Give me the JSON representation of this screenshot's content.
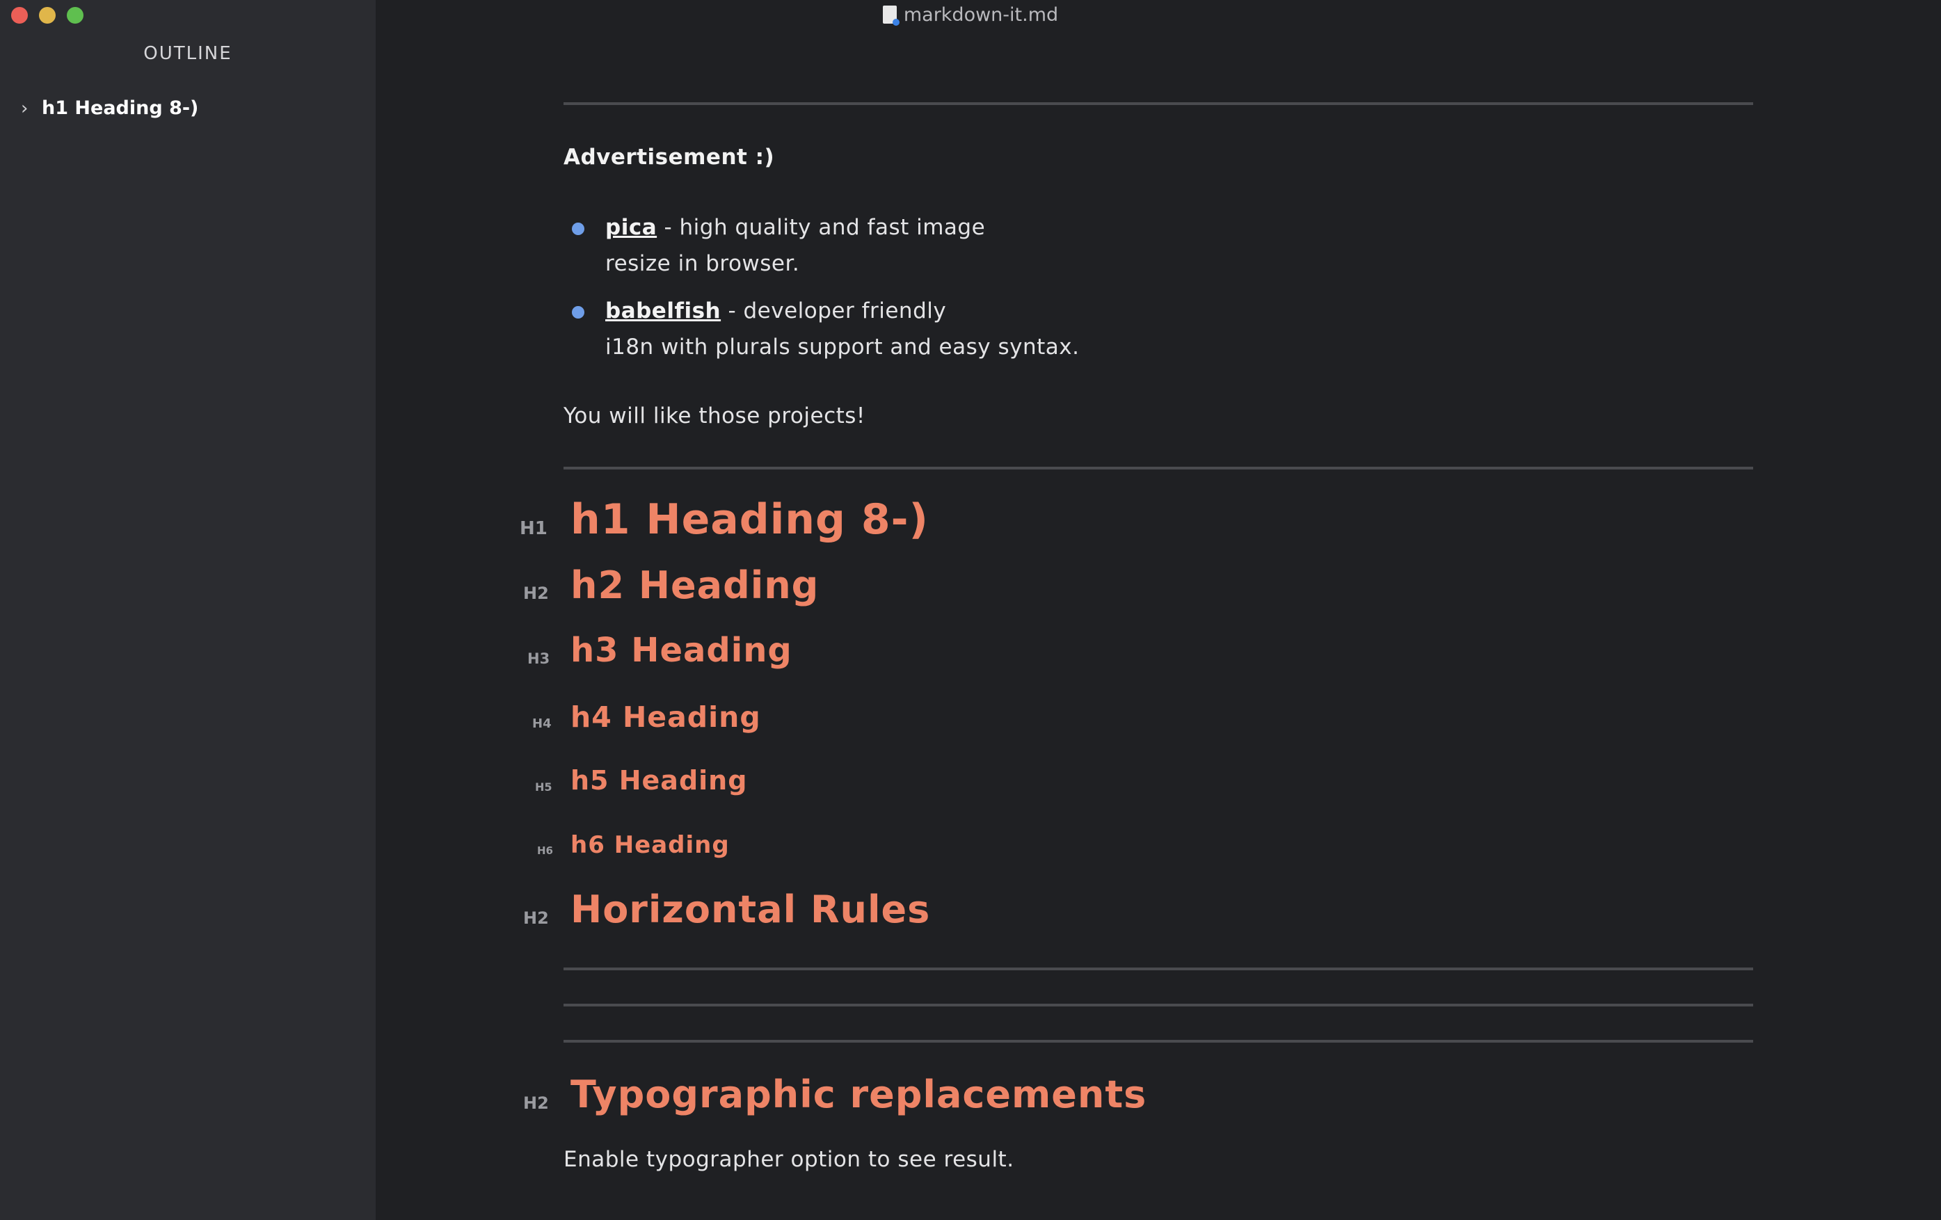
{
  "window": {
    "title": "markdown-it.md"
  },
  "sidebar": {
    "title": "OUTLINE",
    "items": [
      {
        "label": "h1 Heading 8-)"
      }
    ]
  },
  "content": {
    "advertisement": "Advertisement :)",
    "list": [
      {
        "link": "pica",
        "text_line1": " - high quality and fast image",
        "text_line2": "resize in browser."
      },
      {
        "link": "babelfish",
        "text_line1": " - developer friendly",
        "text_line2": "i18n with plurals support and easy syntax."
      }
    ],
    "closing": "You will like those projects!",
    "headings": [
      {
        "level": "H1",
        "text": "h1 Heading 8-)"
      },
      {
        "level": "H2",
        "text": "h2 Heading"
      },
      {
        "level": "H3",
        "text": "h3 Heading"
      },
      {
        "level": "H4",
        "text": "h4 Heading"
      },
      {
        "level": "H5",
        "text": "h5 Heading"
      },
      {
        "level": "H6",
        "text": "h6 Heading"
      },
      {
        "level": "H2",
        "text": "Horizontal Rules"
      },
      {
        "level": "H2",
        "text": "Typographic replacements"
      }
    ],
    "typographer_note": "Enable typographer option to see result."
  },
  "colors": {
    "heading": "#ee8466",
    "bullet": "#6f9ee8",
    "background": "#1f2023",
    "sidebar_background": "#2b2c30"
  }
}
